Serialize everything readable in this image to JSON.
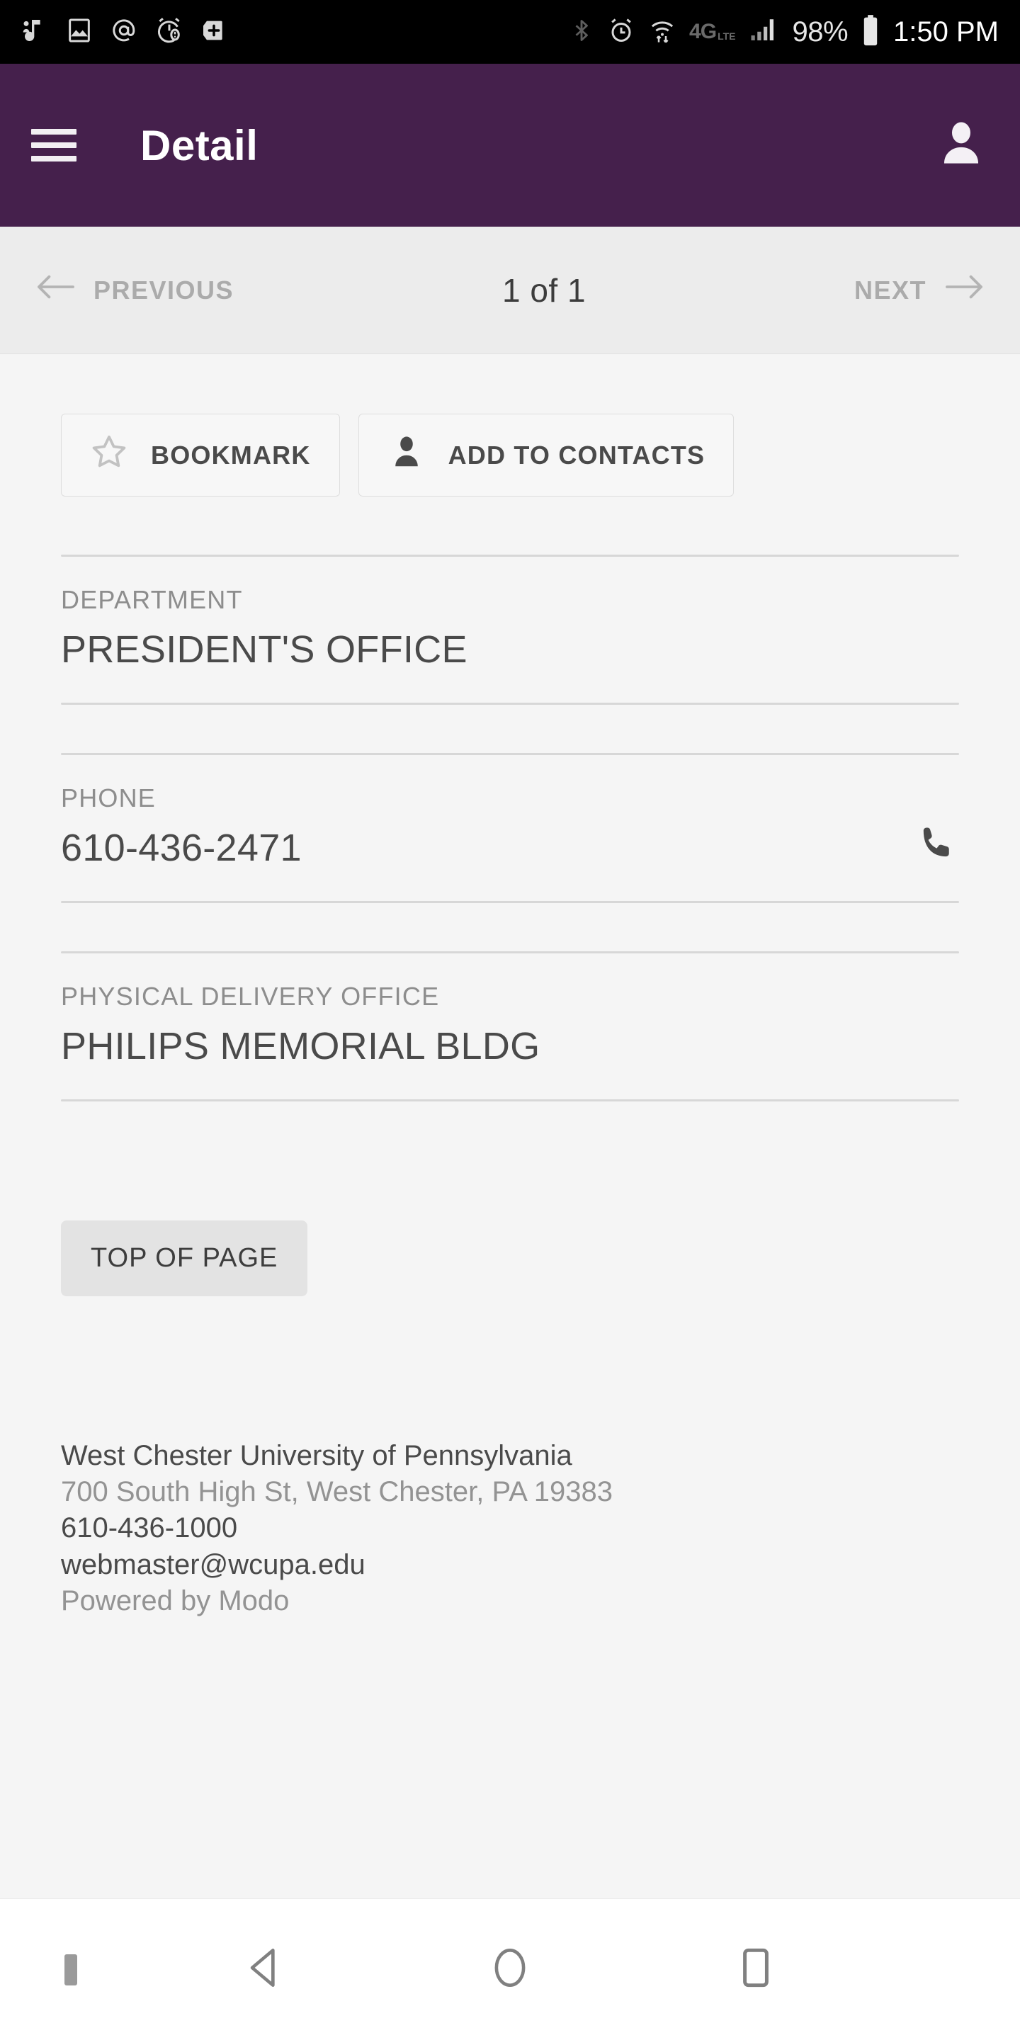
{
  "status_bar": {
    "notification_icons": [
      "music-note-icon",
      "image-icon",
      "email-at-icon",
      "alarm-warning-icon",
      "add-box-icon"
    ],
    "system_icons": [
      "bluetooth-icon",
      "alarm-clock-icon",
      "wifi-data-transfer-icon",
      "signal-bars-icon"
    ],
    "network_type": "4G",
    "network_sub": "LTE",
    "battery_percent": "98%",
    "time": "1:50 PM"
  },
  "appbar": {
    "menu_icon": "hamburger-menu-icon",
    "title": "Detail",
    "account_icon": "account-person-icon",
    "background": "#45204C"
  },
  "pager": {
    "previous_label": "PREVIOUS",
    "next_label": "NEXT",
    "count_label": "1 of 1",
    "previous_enabled": false,
    "next_enabled": false
  },
  "actions": {
    "bookmark_label": "BOOKMARK",
    "bookmark_icon": "star-outline-icon",
    "add_contacts_label": "ADD TO CONTACTS",
    "add_contacts_icon": "person-filled-icon"
  },
  "fields": [
    {
      "label": "DEPARTMENT",
      "value": "PRESIDENT'S OFFICE",
      "action_icon": null
    },
    {
      "label": "PHONE",
      "value": "610-436-2471",
      "action_icon": "phone-call-icon"
    },
    {
      "label": "PHYSICAL DELIVERY OFFICE",
      "value": "PHILIPS MEMORIAL BLDG",
      "action_icon": null
    }
  ],
  "top_of_page": {
    "label": "TOP OF PAGE"
  },
  "footer": {
    "organization": "West Chester University of Pennsylvania",
    "address": "700 South High St, West Chester, PA 19383",
    "phone": "610-436-1000",
    "email": "webmaster@wcupa.edu",
    "powered_by": "Powered by Modo"
  },
  "navbar": {
    "back_icon": "back-triangle-icon",
    "home_icon": "home-circle-icon",
    "recents_icon": "recents-square-icon",
    "keyboard_dot": "keyboard-indicator-dot"
  }
}
